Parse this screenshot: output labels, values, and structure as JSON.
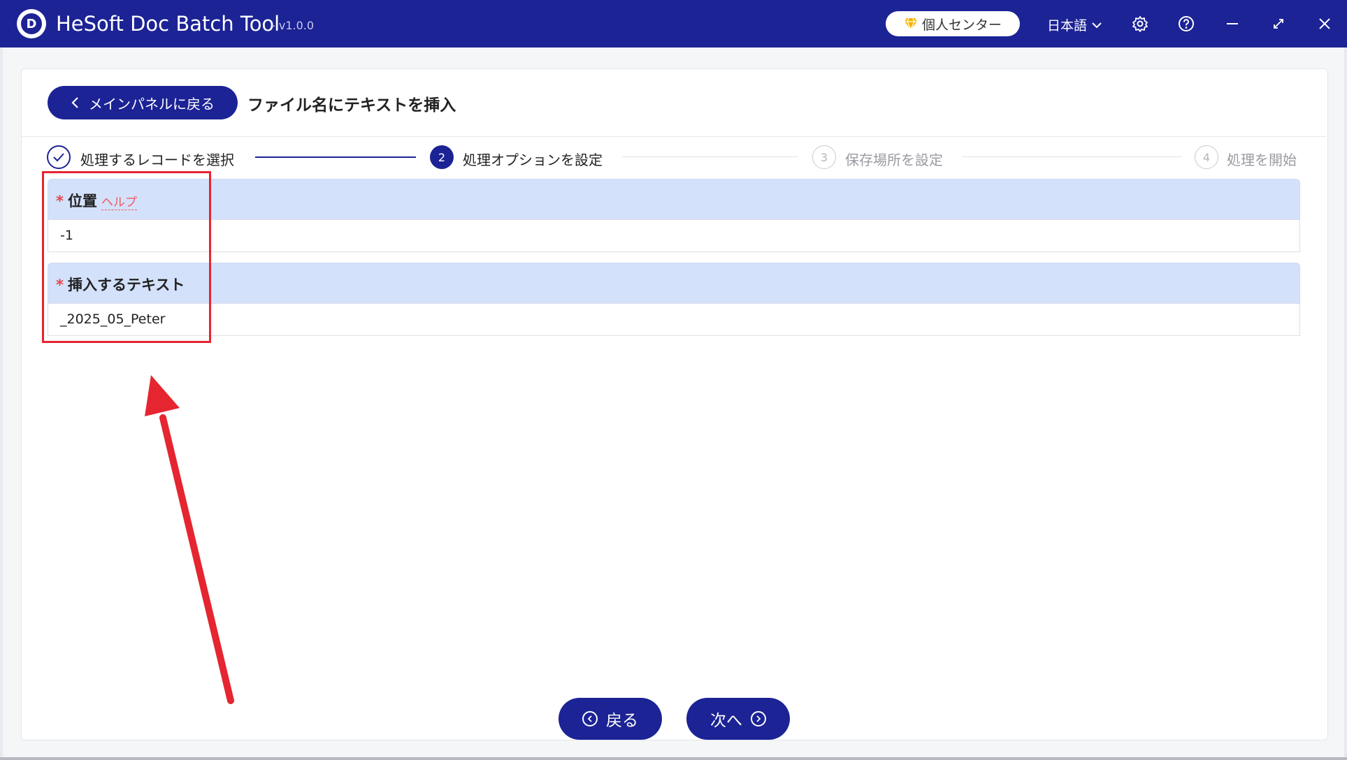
{
  "window": {
    "app_name": "HeSoft Doc Batch Tool",
    "version": "- v1.0.0",
    "logo_letter": "D",
    "user_center_label": "個人センター",
    "language_label": "日本語",
    "icons": [
      "gem-icon",
      "chevron-down-icon",
      "gear-icon",
      "help-icon",
      "minimize-icon",
      "maximize-icon",
      "close-icon"
    ],
    "colors": {
      "titlebar": "#1c2395",
      "accent": "#1c2395",
      "field_header": "#d4e1fb",
      "required": "#e5484d",
      "annotation": "#e52530"
    }
  },
  "header": {
    "back_button_label": "メインパネルに戻る",
    "page_title": "ファイル名にテキストを挿入"
  },
  "steps": [
    {
      "number": "1",
      "label": "処理するレコードを選択",
      "state": "completed"
    },
    {
      "number": "2",
      "label": "処理オプションを設定",
      "state": "active"
    },
    {
      "number": "3",
      "label": "保存場所を設定",
      "state": "pending"
    },
    {
      "number": "4",
      "label": "処理を開始",
      "state": "pending"
    }
  ],
  "form": {
    "position": {
      "required_mark": "*",
      "label": "位置",
      "help_label": "ヘルプ",
      "value": "-1"
    },
    "insert_text": {
      "required_mark": "*",
      "label": "挿入するテキスト",
      "value": "_2025_05_Peter"
    }
  },
  "footer": {
    "back_label": "戻る",
    "next_label": "次へ"
  }
}
